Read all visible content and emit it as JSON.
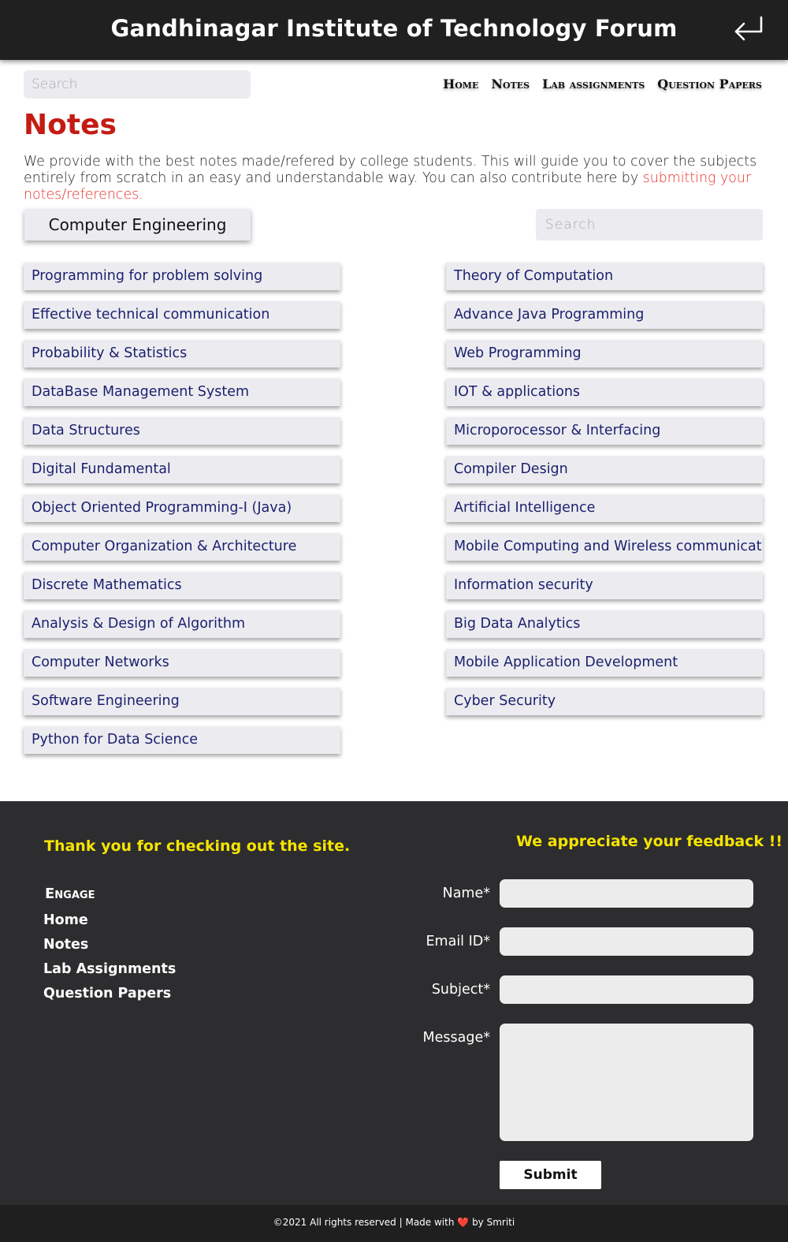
{
  "header": {
    "title": "Gandhinagar Institute of Technology Forum",
    "back_icon": "return-arrow-icon"
  },
  "search": {
    "placeholder": "Search"
  },
  "nav": {
    "items": [
      {
        "label": "Home"
      },
      {
        "label": "Notes"
      },
      {
        "label": "Lab assignments"
      },
      {
        "label": "Question Papers"
      }
    ]
  },
  "notes": {
    "title": "Notes",
    "intro_text": "We provide with the best notes made/refered by college students. This will guide you to cover the subjects entirely from scratch in an easy and understandable way. You can also contribute here by ",
    "intro_link": "submitting your notes/references.",
    "branch": "Computer Engineering",
    "subject_search_placeholder": "Search",
    "subjects_left": [
      "Programming for problem solving",
      "Effective technical communication",
      "Probability & Statistics",
      "DataBase Management System",
      "Data Structures",
      "Digital Fundamental",
      "Object Oriented Programming-I (Java)",
      "Computer Organization & Architecture",
      "Discrete Mathematics",
      "Analysis & Design of Algorithm",
      "Computer Networks",
      "Software Engineering",
      "Python for Data Science"
    ],
    "subjects_right": [
      "Theory of Computation",
      "Advance Java Programming",
      "Web Programming",
      "IOT & applications",
      "Microporocessor & Interfacing",
      "Compiler Design",
      "Artificial Intelligence",
      "Mobile Computing and Wireless communication",
      "Information security",
      "Big Data Analytics",
      "Mobile Application Development",
      "Cyber Security"
    ]
  },
  "footer": {
    "thanks": "Thank you for checking out the site.",
    "engage_title": "Engage",
    "engage_links": [
      {
        "label": "Home"
      },
      {
        "label": "Notes"
      },
      {
        "label": "Lab Assignments"
      },
      {
        "label": "Question Papers"
      }
    ],
    "feedback_title": "We appreciate your feedback !!",
    "form": {
      "name_label": "Name*",
      "email_label": "Email ID*",
      "subject_label": "Subject*",
      "message_label": "Message*",
      "submit_label": "Submit"
    },
    "copyright_prefix": "©2021 All rights reserved | Made with",
    "heart": "❤️",
    "copyright_suffix": "by Smriti"
  },
  "colors": {
    "header_bg": "#202020",
    "title_red": "#c41b14",
    "link_red": "#e8302a",
    "subject_text": "#1a1f6e",
    "footer_bg": "#2d2c2e",
    "footer_yellow": "#f5e400"
  }
}
